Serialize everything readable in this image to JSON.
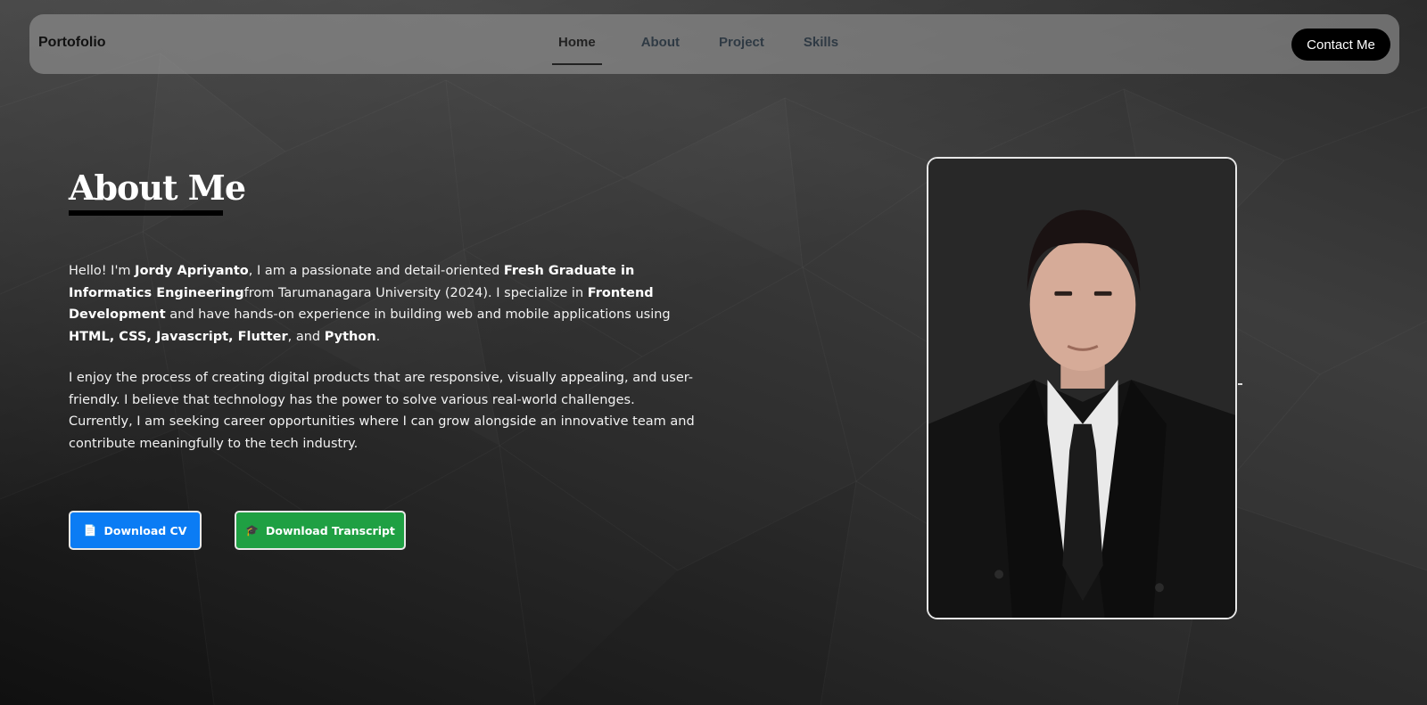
{
  "navbar": {
    "brand": "Portofolio",
    "links": [
      {
        "label": "Home",
        "active": true
      },
      {
        "label": "About",
        "active": false
      },
      {
        "label": "Project",
        "active": false
      },
      {
        "label": "Skills",
        "active": false
      }
    ],
    "contact_label": "Contact Me"
  },
  "about": {
    "title": "About Me",
    "paragraph1": [
      {
        "text": "Hello! I'm ",
        "bold": false
      },
      {
        "text": "Jordy Apriyanto",
        "bold": true
      },
      {
        "text": ", I am a passionate and detail-oriented ",
        "bold": false
      },
      {
        "text": "Fresh Graduate in Informatics Engineering",
        "bold": true
      },
      {
        "text": "from Tarumanagara University (2024). I specialize in ",
        "bold": false
      },
      {
        "text": "Frontend Development",
        "bold": true
      },
      {
        "text": " and have hands-on experience in building web and mobile applications using ",
        "bold": false
      },
      {
        "text": "HTML, CSS, Javascript, Flutter",
        "bold": true
      },
      {
        "text": ", and ",
        "bold": false
      },
      {
        "text": "Python",
        "bold": true
      },
      {
        "text": ".",
        "bold": false
      }
    ],
    "paragraph2": "I enjoy the process of creating digital products that are responsive, visually appealing, and user-friendly. I believe that technology has the power to solve various real-world challenges. Currently, I am seeking career opportunities where I can grow alongside an innovative team and contribute meaningfully to the tech industry.",
    "buttons": {
      "cv_icon": "📄",
      "cv_label": "Download CV",
      "transcript_icon": "🎓",
      "transcript_label": "Download Transcript"
    }
  },
  "colors": {
    "cv_button": "#0b7cf4",
    "transcript_button": "#1fa043",
    "contact_button": "#000000"
  },
  "icons": {
    "cv": "document-icon",
    "transcript": "graduation-cap-icon"
  }
}
